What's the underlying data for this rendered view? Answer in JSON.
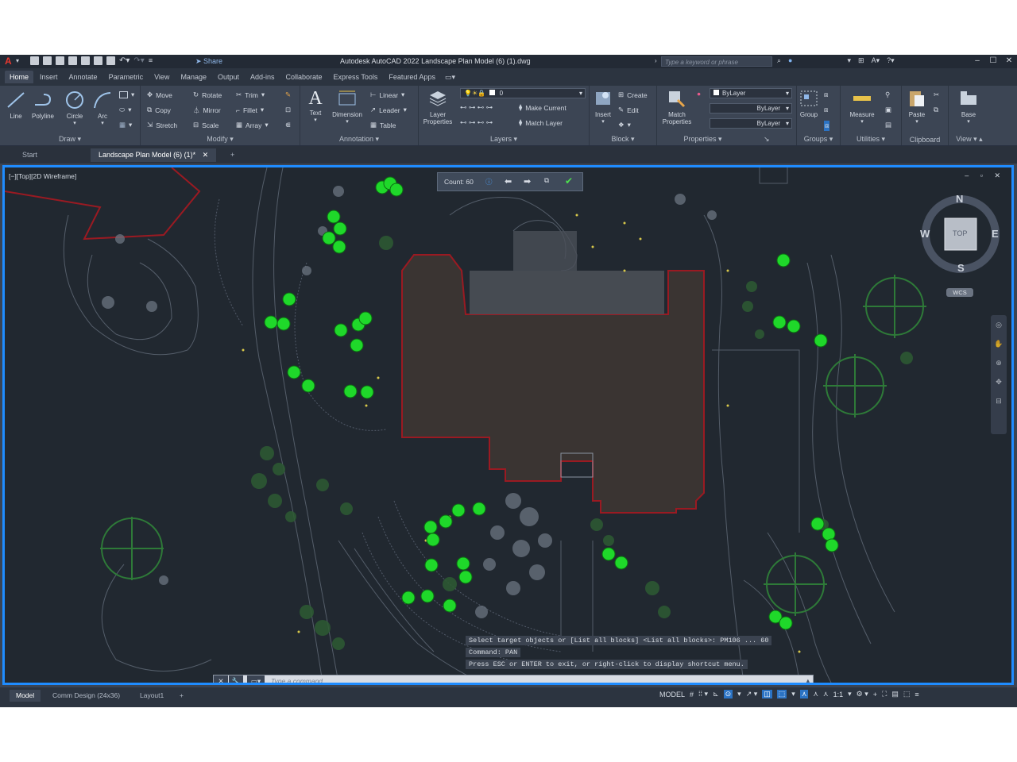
{
  "app": {
    "logo": "A",
    "title": "Autodesk AutoCAD 2022    Landscape Plan Model (6) (1).dwg",
    "share_label": "Share",
    "search_placeholder": "Type a keyword or phrase"
  },
  "ribbon_tabs": [
    "Home",
    "Insert",
    "Annotate",
    "Parametric",
    "View",
    "Manage",
    "Output",
    "Add-ins",
    "Collaborate",
    "Express Tools",
    "Featured Apps"
  ],
  "ribbon": {
    "draw": {
      "title": "Draw",
      "line": "Line",
      "polyline": "Polyline",
      "circle": "Circle",
      "arc": "Arc"
    },
    "modify": {
      "title": "Modify",
      "move": "Move",
      "rotate": "Rotate",
      "trim": "Trim",
      "copy": "Copy",
      "mirror": "Mirror",
      "fillet": "Fillet",
      "stretch": "Stretch",
      "scale": "Scale",
      "array": "Array"
    },
    "annotation": {
      "title": "Annotation",
      "text": "Text",
      "dimension": "Dimension",
      "linear": "Linear",
      "leader": "Leader",
      "table": "Table"
    },
    "layers": {
      "title": "Layers",
      "layer_properties": "Layer Properties",
      "layer_value": "0",
      "make_current": "Make Current",
      "match_layer": "Match Layer"
    },
    "block": {
      "title": "Block",
      "insert": "Insert",
      "create": "Create",
      "edit": "Edit"
    },
    "properties": {
      "title": "Properties",
      "match_properties": "Match Properties",
      "color": "ByLayer",
      "linetype": "ByLayer",
      "lineweight": "ByLayer"
    },
    "groups": {
      "title": "Groups",
      "group": "Group"
    },
    "utilities": {
      "title": "Utilities",
      "measure": "Measure"
    },
    "clipboard": {
      "title": "Clipboard",
      "paste": "Paste"
    },
    "view": {
      "title": "View",
      "base": "Base"
    }
  },
  "doc_tabs": {
    "start": "Start",
    "active": "Landscape Plan Model (6) (1)*"
  },
  "viewport": {
    "label": "[−][Top][2D Wireframe]",
    "count_label": "Count: 60",
    "compass": {
      "n": "N",
      "s": "S",
      "e": "E",
      "w": "W",
      "cube": "TOP",
      "wcs": "WCS"
    }
  },
  "command": {
    "history": [
      "Select target objects or [List all blocks] <List all blocks>: PM106 ... 60",
      "Command: PAN",
      "Press ESC or ENTER to exit, or right-click to display shortcut menu."
    ],
    "placeholder": "Type a command"
  },
  "layout_tabs": [
    "Model",
    "Comm Design (24x36)",
    "Layout1"
  ],
  "status": {
    "model": "MODEL",
    "scale": "1:1"
  },
  "colors": {
    "accent": "#1f8cff",
    "highlight": "#20e020",
    "outline": "#9a1a22",
    "footprint": "#3a3432"
  }
}
